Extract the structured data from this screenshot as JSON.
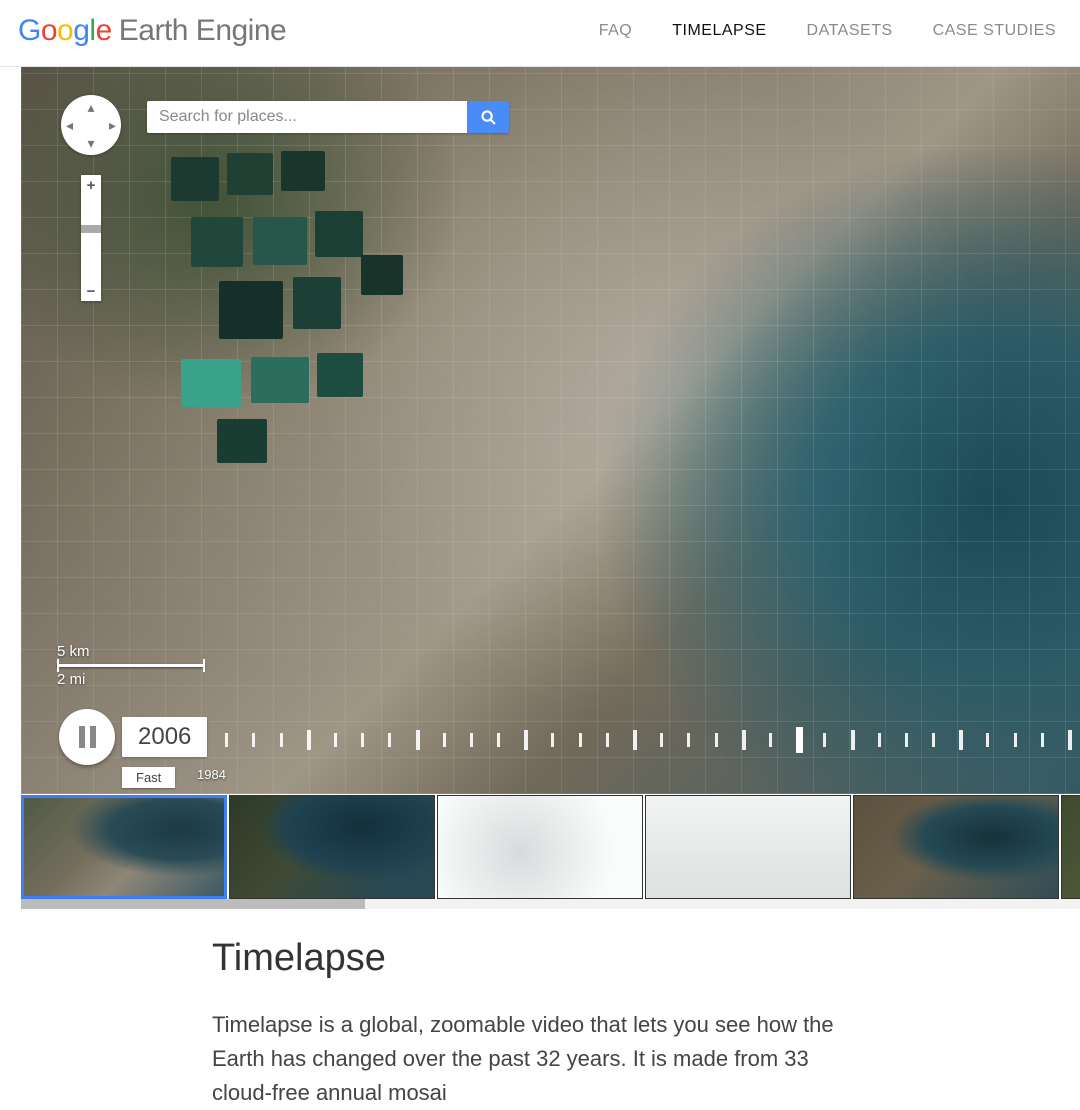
{
  "header": {
    "logo_google": "Google",
    "logo_ee": "Earth Engine",
    "nav": [
      {
        "label": "FAQ",
        "active": false
      },
      {
        "label": "TIMELAPSE",
        "active": true
      },
      {
        "label": "DATASETS",
        "active": false
      },
      {
        "label": "CASE STUDIES",
        "active": false
      }
    ]
  },
  "map": {
    "search_placeholder": "Search for places...",
    "scalebar_km": "5 km",
    "scalebar_mi": "2 mi",
    "timeline": {
      "current_year": "2006",
      "speed": "Fast",
      "start_year": "1984",
      "tick_count": 33,
      "active_tick_index": 22
    }
  },
  "article": {
    "title": "Timelapse",
    "body": "Timelapse is a global, zoomable video that lets you see how the Earth has changed over the past 32 years. It is made from 33 cloud-free annual mosai"
  },
  "colors": {
    "accent": "#4a8cf7",
    "selected": "#3e7df5"
  }
}
